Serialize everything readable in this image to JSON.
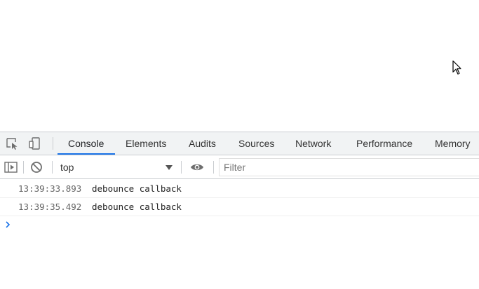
{
  "devtools": {
    "tabs": [
      {
        "label": "Console",
        "active": true
      },
      {
        "label": "Elements",
        "active": false
      },
      {
        "label": "Audits",
        "active": false
      },
      {
        "label": "Sources",
        "active": false
      },
      {
        "label": "Network",
        "active": false
      },
      {
        "label": "Performance",
        "active": false
      },
      {
        "label": "Memory",
        "active": false
      }
    ],
    "toolbar": {
      "context": "top",
      "filter_placeholder": "Filter"
    },
    "logs": [
      {
        "timestamp": "13:39:33.893",
        "message": "debounce callback"
      },
      {
        "timestamp": "13:39:35.492",
        "message": "debounce callback"
      }
    ],
    "colors": {
      "accent": "#1a73e8",
      "tabbar_bg": "#f1f3f4",
      "border": "#cacdd1"
    }
  }
}
